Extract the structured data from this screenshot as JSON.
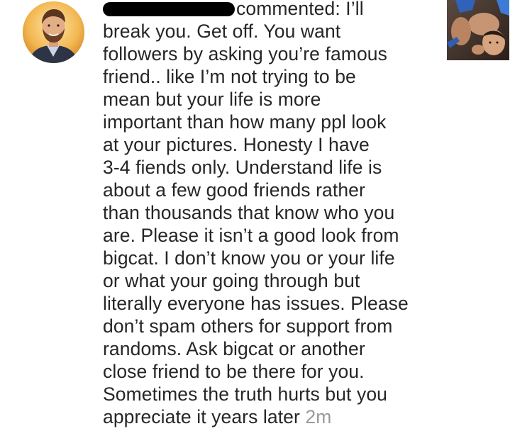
{
  "notification": {
    "username_redacted": "",
    "comment_lines": [
      "commented: I’ll",
      "break you. Get off. You want",
      "followers by asking you’re famous",
      "friend.. like I’m not trying to be",
      "mean but your life is more",
      "important than how many ppl look",
      "at your pictures. Honesty I have",
      "3-4 fiends only. Understand life is",
      "about a few good friends rather",
      "than thousands that know who you",
      "are. Please it isn’t a good look from",
      "bigcat. I don’t know you or your life",
      "or what your going through but",
      "literally everyone has issues. Please",
      "don’t spam others for support from",
      "randoms. Ask bigcat or another",
      "close friend to be there for you.",
      "Sometimes the truth hurts but you",
      "appreciate it years later"
    ],
    "timestamp": "2m",
    "avatar_icon": "user-avatar-photo",
    "thumbnail_icon": "post-thumbnail-photo",
    "colors": {
      "text": "#262626",
      "timestamp": "#9a9a9a",
      "redaction": "#000000",
      "background": "#ffffff"
    }
  }
}
